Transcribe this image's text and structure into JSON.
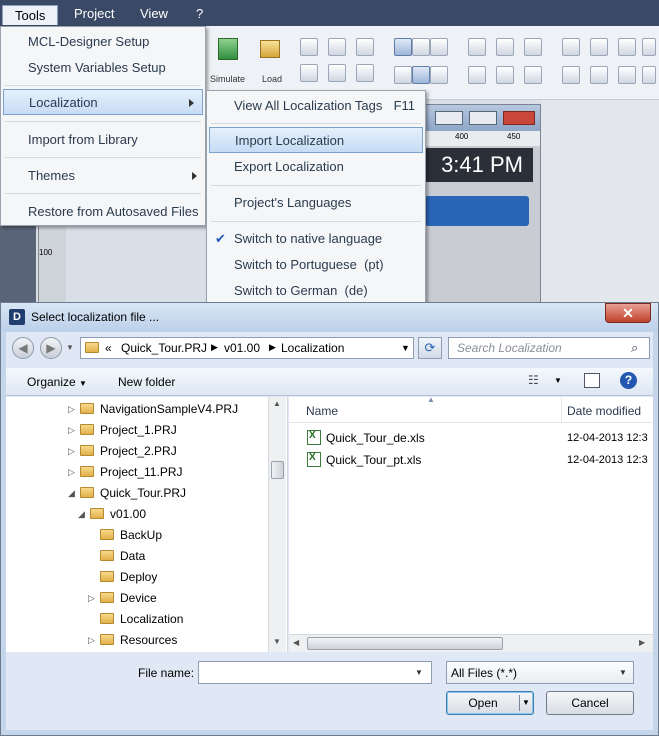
{
  "menubar": {
    "items": [
      "Tools",
      "Project",
      "View",
      "?"
    ]
  },
  "toolbar": {
    "simulate_label": "Simulate",
    "load_label": "Load"
  },
  "preview": {
    "ruler": [
      "400",
      "450"
    ],
    "clock": "3:41 PM"
  },
  "ruler_left": {
    "tick": "100"
  },
  "tools_menu": {
    "items": [
      "MCL-Designer Setup",
      "System Variables Setup",
      "Localization",
      "Import from Library",
      "Themes",
      "Restore from Autosaved Files"
    ]
  },
  "localization_menu": {
    "items": [
      "View All Localization Tags",
      "Import Localization",
      "Export Localization",
      "Project's Languages",
      "Switch to native language",
      "Switch to Portuguese  (pt)",
      "Switch to German  (de)"
    ],
    "shortcut": "F11"
  },
  "dialog": {
    "icon": "D",
    "title": "Select localization file ...",
    "breadcrumb": [
      "«",
      "Quick_Tour.PRJ",
      "v01.00",
      "Localization"
    ],
    "search_placeholder": "Search Localization",
    "organize": "Organize",
    "new_folder": "New folder",
    "tree": [
      "NavigationSampleV4.PRJ",
      "Project_1.PRJ",
      "Project_2.PRJ",
      "Project_11.PRJ",
      "Quick_Tour.PRJ",
      "v01.00",
      "BackUp",
      "Data",
      "Deploy",
      "Device",
      "Localization",
      "Resources"
    ],
    "columns": {
      "name": "Name",
      "date": "Date modified"
    },
    "files": [
      {
        "name": "Quick_Tour_de.xls",
        "date": "12-04-2013 12:3"
      },
      {
        "name": "Quick_Tour_pt.xls",
        "date": "12-04-2013 12:3"
      }
    ],
    "filename_label": "File name:",
    "filter": "All Files (*.*)",
    "open": "Open",
    "cancel": "Cancel"
  }
}
